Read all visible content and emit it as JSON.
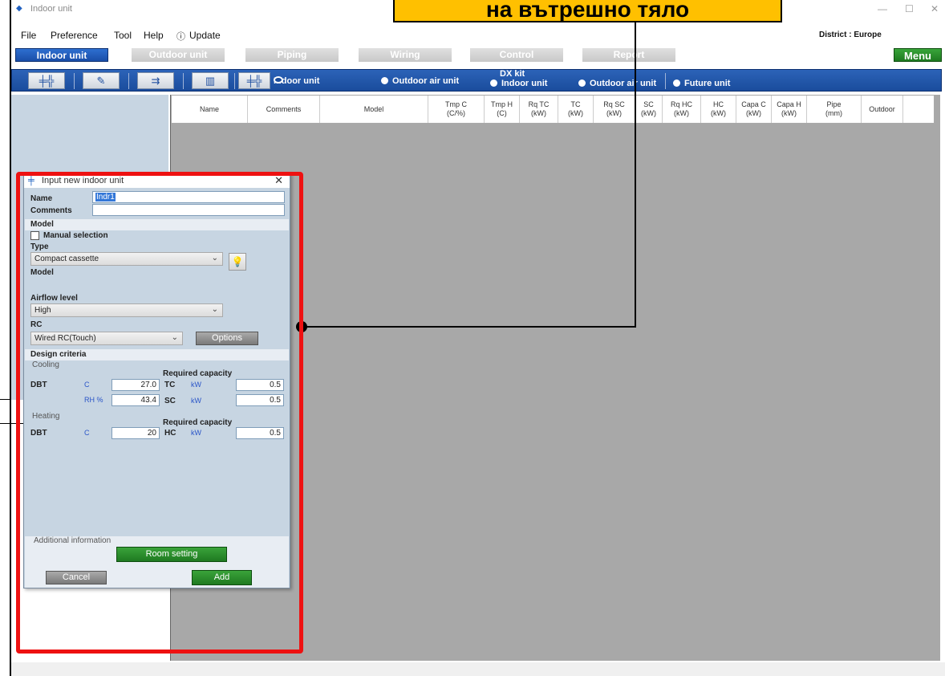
{
  "callout": {
    "text": "на вътрешно тяло"
  },
  "window": {
    "title": "Indoor unit",
    "minimize": "—",
    "maximize": "☐",
    "close": "✕"
  },
  "menu": {
    "file": "File",
    "preference": "Preference",
    "tool": "Tool",
    "help": "Help",
    "update": "Update",
    "district": "District : Europe"
  },
  "tabs": [
    "Indoor unit",
    "Outdoor unit",
    "Piping",
    "Wiring",
    "Control",
    "Report"
  ],
  "menu_button": "Menu",
  "toolbar": {
    "radio_indoor": "Indoor unit",
    "radio_outdoor_air": "Outdoor air unit",
    "dx_kit": "DX kit",
    "dx_indoor": "Indoor unit",
    "dx_outdoor_air": "Outdoor air unit",
    "future_unit": "Future unit"
  },
  "grid": {
    "columns": [
      {
        "l1": "Name",
        "l2": ""
      },
      {
        "l1": "Comments",
        "l2": ""
      },
      {
        "l1": "Model",
        "l2": ""
      },
      {
        "l1": "Tmp C",
        "l2": "(C/%)"
      },
      {
        "l1": "Tmp H",
        "l2": "(C)"
      },
      {
        "l1": "Rq TC",
        "l2": "(kW)"
      },
      {
        "l1": "TC",
        "l2": "(kW)"
      },
      {
        "l1": "Rq SC",
        "l2": "(kW)"
      },
      {
        "l1": "SC",
        "l2": "(kW)"
      },
      {
        "l1": "Rq HC",
        "l2": "(kW)"
      },
      {
        "l1": "HC",
        "l2": "(kW)"
      },
      {
        "l1": "Capa C",
        "l2": "(kW)"
      },
      {
        "l1": "Capa H",
        "l2": "(kW)"
      },
      {
        "l1": "Pipe",
        "l2": "(mm)"
      },
      {
        "l1": "Outdoor",
        "l2": ""
      }
    ]
  },
  "dialog": {
    "title": "Input new indoor unit",
    "close": "✕",
    "name_label": "Name",
    "name_value": "Indr1",
    "comments_label": "Comments",
    "comments_value": "",
    "model_section": "Model",
    "manual_selection": "Manual selection",
    "type_label": "Type",
    "type_value": "Compact cassette",
    "model_label": "Model",
    "airflow_label": "Airflow level",
    "airflow_value": "High",
    "rc_label": "RC",
    "rc_value": "Wired RC(Touch)",
    "options_button": "Options",
    "design_criteria": "Design criteria",
    "cooling": {
      "group": "Cooling",
      "required_capacity": "Required capacity",
      "dbt": "DBT",
      "c_unit": "C",
      "dbt_value": "27.0",
      "rh_unit": "RH %",
      "rh_value": "43.4",
      "tc": "TC",
      "tc_unit": "kW",
      "tc_value": "0.5",
      "sc": "SC",
      "sc_unit": "kW",
      "sc_value": "0.5"
    },
    "heating": {
      "group": "Heating",
      "required_capacity": "Required capacity",
      "dbt": "DBT",
      "c_unit": "C",
      "dbt_value": "20",
      "hc": "HC",
      "hc_unit": "kW",
      "hc_value": "0.5"
    },
    "additional_information": "Additional information",
    "room_setting": "Room setting",
    "cancel": "Cancel",
    "add": "Add"
  }
}
